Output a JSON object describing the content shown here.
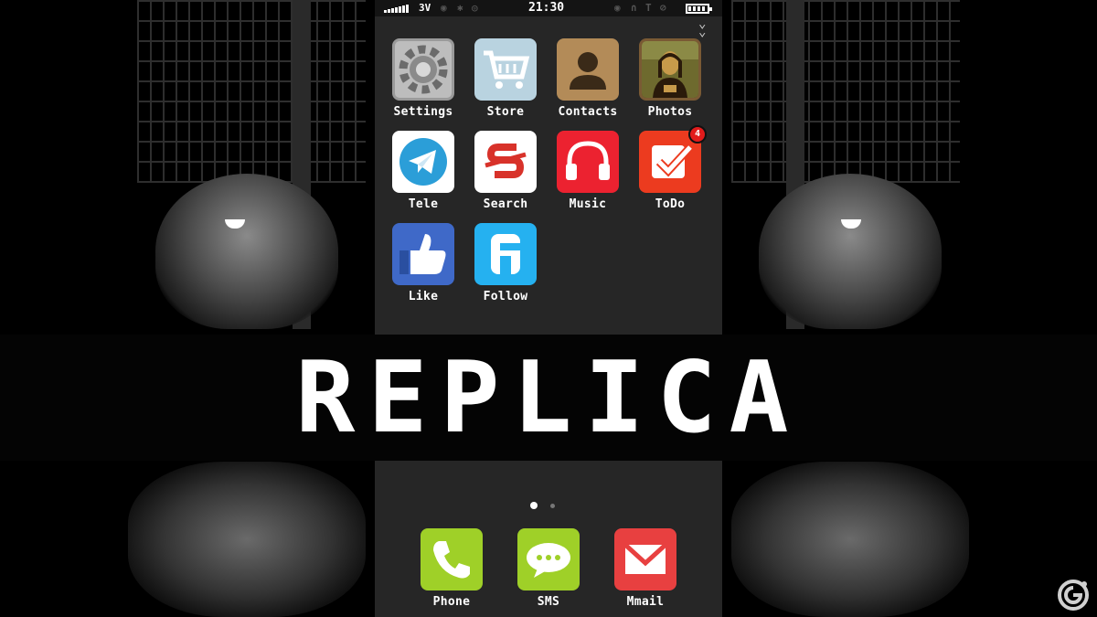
{
  "title": "REPLICA",
  "status_bar": {
    "network": "3V",
    "time": "21:30"
  },
  "apps": [
    {
      "label": "Settings",
      "icon": "gear-icon"
    },
    {
      "label": "Store",
      "icon": "shopping-cart-icon"
    },
    {
      "label": "Contacts",
      "icon": "person-icon"
    },
    {
      "label": "Photos",
      "icon": "mona-lisa-photo-icon"
    },
    {
      "label": "Tele",
      "icon": "paper-plane-icon"
    },
    {
      "label": "Search",
      "icon": "search-s-icon"
    },
    {
      "label": "Music",
      "icon": "headphones-icon"
    },
    {
      "label": "ToDo",
      "icon": "checkmark-icon",
      "badge": "4"
    },
    {
      "label": "Like",
      "icon": "thumbs-up-icon"
    },
    {
      "label": "Follow",
      "icon": "f-letter-icon"
    }
  ],
  "page_indicator": {
    "current": 1,
    "total": 2
  },
  "dock": [
    {
      "label": "Phone",
      "icon": "phone-handset-icon"
    },
    {
      "label": "SMS",
      "icon": "speech-bubble-icon"
    },
    {
      "label": "Mmail",
      "icon": "envelope-icon"
    }
  ],
  "colors": {
    "phone_bg": "#262626",
    "settings_bg": "#bdbdbd",
    "store_bg": "#b9d3e0",
    "contacts_bg": "#b38b58",
    "tele_bg": "#ffffff",
    "search_bg": "#ffffff",
    "music_bg": "#ec2230",
    "todo_bg": "#ec3b1f",
    "like_bg": "#3f69c8",
    "follow_bg": "#25b1f0",
    "phone_app_bg": "#9fd028",
    "sms_bg": "#9fd028",
    "mmail_bg": "#e84040",
    "badge": "#e21b1b"
  }
}
